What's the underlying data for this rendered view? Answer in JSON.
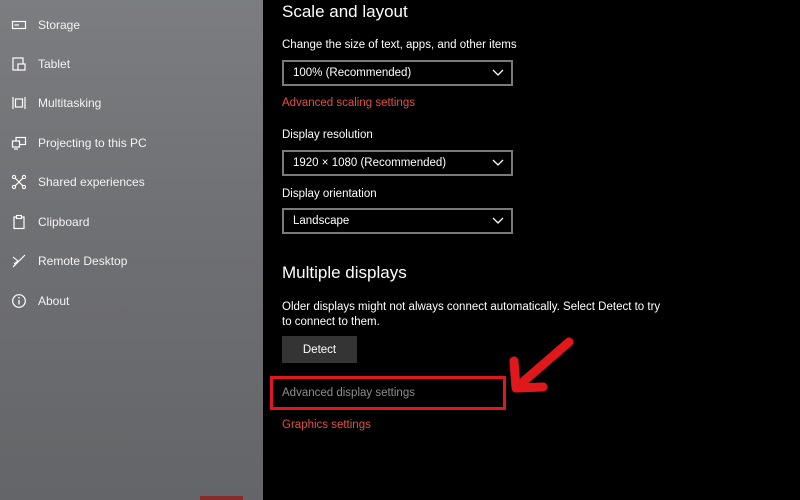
{
  "sidebar": {
    "items": [
      {
        "label": "Storage",
        "icon": "storage-icon"
      },
      {
        "label": "Tablet",
        "icon": "tablet-icon"
      },
      {
        "label": "Multitasking",
        "icon": "multitasking-icon"
      },
      {
        "label": "Projecting to this PC",
        "icon": "projecting-icon"
      },
      {
        "label": "Shared experiences",
        "icon": "shared-experiences-icon"
      },
      {
        "label": "Clipboard",
        "icon": "clipboard-icon"
      },
      {
        "label": "Remote Desktop",
        "icon": "remote-desktop-icon"
      },
      {
        "label": "About",
        "icon": "info-icon"
      }
    ]
  },
  "scale_layout": {
    "heading": "Scale and layout",
    "size_label": "Change the size of text, apps, and other items",
    "size_value": "100% (Recommended)",
    "advanced_scaling_link": "Advanced scaling settings",
    "resolution_label": "Display resolution",
    "resolution_value": "1920 × 1080 (Recommended)",
    "orientation_label": "Display orientation",
    "orientation_value": "Landscape"
  },
  "multiple_displays": {
    "heading": "Multiple displays",
    "description": "Older displays might not always connect automatically. Select Detect to try to connect to them.",
    "detect_button": "Detect",
    "advanced_display_link": "Advanced display settings",
    "graphics_link": "Graphics settings"
  },
  "colors": {
    "accent_link": "#e2504a",
    "annotation_red": "#e0171b",
    "sidebar_bg": "#707174"
  }
}
